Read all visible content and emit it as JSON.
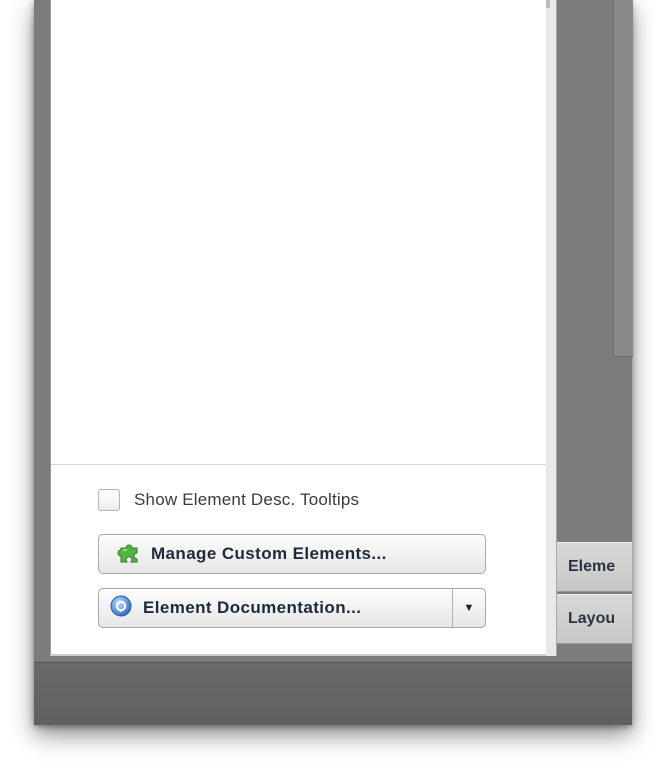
{
  "panel": {
    "tooltip_checkbox_label": "Show Element Desc. Tooltips",
    "tooltip_checkbox_checked": false
  },
  "buttons": {
    "manage_custom_elements": "Manage Custom Elements...",
    "element_documentation": "Element Documentation..."
  },
  "right_tabs": [
    "Eleme",
    "Layou"
  ],
  "icons": {
    "manage": "puzzle-piece-icon",
    "documentation": "help-icon",
    "dropdown": "dropdown-arrow-icon"
  },
  "colors": {
    "window_gray": "#7c7c7c",
    "button_text": "#1e2a3a",
    "puzzle_green": "#4caf3a",
    "help_blue": "#3a7fd0"
  }
}
